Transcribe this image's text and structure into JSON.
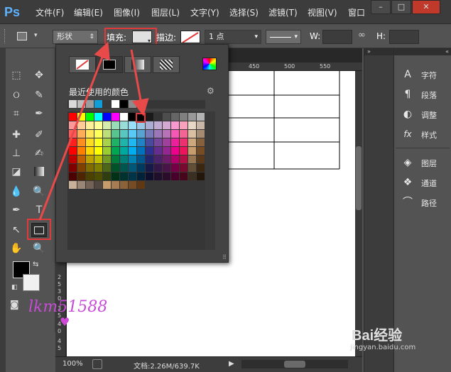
{
  "app": {
    "logo": "Ps"
  },
  "menu": [
    "文件(F)",
    "编辑(E)",
    "图像(I)",
    "图层(L)",
    "文字(Y)",
    "选择(S)",
    "滤镜(T)",
    "视图(V)",
    "窗口"
  ],
  "window_buttons": [
    "–",
    "□",
    "✕"
  ],
  "options": {
    "mode_label": "形状",
    "fill_label": "填充:",
    "stroke_label": "描边:",
    "stroke_width": "1 点",
    "w_label": "W:",
    "h_label": "H:"
  },
  "rulers": {
    "top": [
      "450",
      "500",
      "550"
    ],
    "left": [
      "2",
      "5",
      "3",
      "0",
      "3",
      "5",
      "4",
      "0",
      "4",
      "5"
    ]
  },
  "status": {
    "zoom": "100%",
    "doc": "文档:2.26M/639.7K"
  },
  "popup": {
    "recent_label": "最近使用的颜色",
    "gear": "⚙",
    "recent_colors": [
      "#d9d9d9",
      "#bdbdbd",
      "#9c9c9c",
      "#0f9ed8",
      "#3a3a3a",
      "#ffffff",
      "#000000",
      "#8c8c8c"
    ],
    "grayscale_row": [
      "#000000",
      "#1a1a1a",
      "#333333",
      "#4d4d4d",
      "#666666",
      "#808080",
      "#999999",
      "#b3b3b3",
      "#cccccc",
      "#e6e6e6",
      "#ffffff",
      "#f2f2f2",
      "#d9d9d9",
      "#bfbfbf",
      "#a6a6a6",
      "#8c8c8c"
    ],
    "hue_columns": [
      "#ff0000",
      "#ff7f00",
      "#ffd700",
      "#ffff00",
      "#9acd32",
      "#00a651",
      "#00a99d",
      "#00aeef",
      "#0072bc",
      "#2e3192",
      "#662d91",
      "#92278f",
      "#ec008c",
      "#ed145b",
      "#c69c6d",
      "#754c24"
    ]
  },
  "dock": {
    "items": [
      {
        "label": "字符",
        "icon": "A"
      },
      {
        "label": "段落",
        "icon": "¶"
      },
      {
        "label": "调整",
        "icon": "◐"
      },
      {
        "label": "样式",
        "icon": "fx"
      },
      {
        "label": "图层",
        "icon": "◈"
      },
      {
        "label": "通道",
        "icon": "❖"
      },
      {
        "label": "路径",
        "icon": "⌒"
      }
    ]
  },
  "watermark": {
    "handwriting": "lkm51588",
    "site": "Bai经验",
    "url": "jingyan.baidu.com"
  },
  "colors": {
    "accent_red": "#e23a3a",
    "ps_blue": "#5db3ff"
  }
}
